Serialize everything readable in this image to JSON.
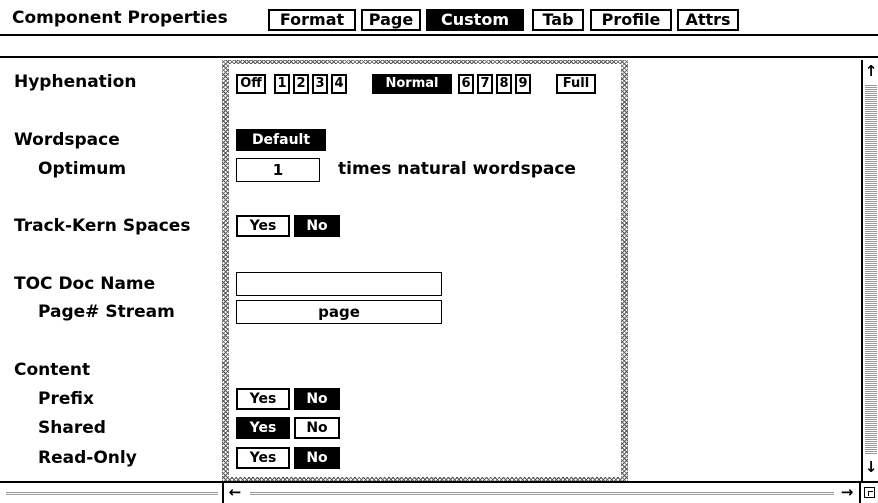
{
  "header": {
    "title": "Component Properties",
    "tabs": [
      {
        "label": "Format",
        "selected": false
      },
      {
        "label": "Page",
        "selected": false
      },
      {
        "label": "Custom",
        "selected": true
      },
      {
        "label": "Tab",
        "selected": false
      },
      {
        "label": "Profile",
        "selected": false
      },
      {
        "label": "Attrs",
        "selected": false
      }
    ]
  },
  "hyphenation": {
    "label": "Hyphenation",
    "options": [
      "Off",
      "1",
      "2",
      "3",
      "4",
      "Normal",
      "6",
      "7",
      "8",
      "9",
      "Full"
    ],
    "selected": "Normal"
  },
  "wordspace": {
    "label": "Wordspace",
    "button": "Default",
    "optimum_label": "Optimum",
    "optimum_value": "1",
    "optimum_suffix": "times natural wordspace"
  },
  "track_kern": {
    "label": "Track-Kern Spaces",
    "yes": "Yes",
    "no": "No",
    "selected": "No"
  },
  "toc": {
    "doc_name_label": "TOC Doc Name",
    "doc_name_value": "",
    "stream_label": "Page# Stream",
    "stream_value": "page"
  },
  "content": {
    "label": "Content",
    "rows": [
      {
        "label": "Prefix",
        "yes": "Yes",
        "no": "No",
        "selected": "No"
      },
      {
        "label": "Shared",
        "yes": "Yes",
        "no": "No",
        "selected": "Yes"
      },
      {
        "label": "Read-Only",
        "yes": "Yes",
        "no": "No",
        "selected": "No"
      }
    ]
  },
  "scroll": {
    "up_icon": "arrow-up-icon",
    "down_icon": "arrow-down-icon",
    "left_icon": "arrow-left-icon",
    "right_icon": "arrow-right-icon"
  }
}
